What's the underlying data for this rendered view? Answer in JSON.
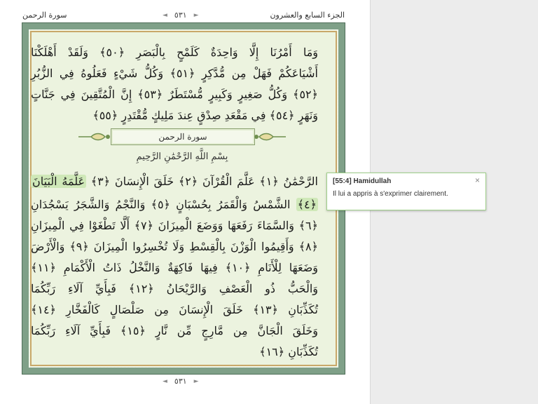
{
  "header": {
    "juz_label": "الجزء السابع والعشرون",
    "surah_label": "سورة الرحمن",
    "page_number": "٥٣١"
  },
  "verses": {
    "line1": "وَمَا أَمْرُنَا إِلَّا وَاحِدَةٌ كَلَمْحٍ بِالْبَصَرِ ﴿٥٠﴾ وَلَقَدْ أَهْلَكْنَا",
    "line2": "أَشْيَاعَكُمْ فَهَلْ مِن مُّدَّكِرٍ ﴿٥١﴾ وَكُلُّ شَيْءٍ فَعَلُوهُ فِي الزُّبُرِ",
    "line3": "﴿٥٢﴾ وَكُلُّ صَغِيرٍ وَكَبِيرٍ مُّسْتَطَرٌ ﴿٥٣﴾ إِنَّ الْمُتَّقِينَ فِي جَنَّاتٍ",
    "line4": "وَنَهَرٍ ﴿٥٤﴾ فِي مَقْعَدِ صِدْقٍ عِندَ مَلِيكٍ مُّقْتَدِرٍ ﴿٥٥﴾",
    "line5": "الرَّحْمَٰنُ ﴿١﴾ عَلَّمَ الْقُرْآنَ ﴿٢﴾ خَلَقَ الْإِنسَانَ ﴿٣﴾",
    "line5_hl": "عَلَّمَهُ الْبَيَانَ",
    "line6_hl": "﴿٤﴾",
    "line6": "الشَّمْسُ وَالْقَمَرُ بِحُسْبَانٍ ﴿٥﴾ وَالنَّجْمُ وَالشَّجَرُ يَسْجُدَانِ",
    "line7": "﴿٦﴾ وَالسَّمَاءَ رَفَعَهَا وَوَضَعَ الْمِيزَانَ ﴿٧﴾ أَلَّا تَطْغَوْا فِي الْمِيزَانِ",
    "line8": "﴿٨﴾ وَأَقِيمُوا الْوَزْنَ بِالْقِسْطِ وَلَا تُخْسِرُوا الْمِيزَانَ ﴿٩﴾ وَالْأَرْضَ",
    "line9": "وَضَعَهَا لِلْأَنَامِ ﴿١٠﴾ فِيهَا فَاكِهَةٌ وَالنَّخْلُ ذَاتُ الْأَكْمَامِ ﴿١١﴾",
    "line10": "وَالْحَبُّ ذُو الْعَصْفِ وَالرَّيْحَانُ ﴿١٢﴾ فَبِأَيِّ آلَاءِ رَبِّكُمَا",
    "line11": "تُكَذِّبَانِ ﴿١٣﴾ خَلَقَ الْإِنسَانَ مِن صَلْصَالٍ كَالْفَخَّارِ ﴿١٤﴾",
    "line12": "وَخَلَقَ الْجَانَّ مِن مَّارِجٍ مِّن نَّارٍ ﴿١٥﴾ فَبِأَيِّ آلَاءِ رَبِّكُمَا",
    "line13": "تُكَذِّبَانِ ﴿١٦﴾"
  },
  "surah_title": "سورة الرحمن",
  "basmala": "بِسْمِ اللَّهِ الرَّحْمَٰنِ الرَّحِيمِ",
  "tooltip": {
    "title": "[55:4] Hamidullah",
    "close": "×",
    "body": "Il lui a appris à s'exprimer clairement."
  },
  "pager_arrows": {
    "left": "◄",
    "right": "►"
  },
  "colors": {
    "frame": "#7fa088",
    "page_bg": "#ecf3df",
    "highlight": "#cfe8b8",
    "tooltip_border": "#9fd08a"
  }
}
